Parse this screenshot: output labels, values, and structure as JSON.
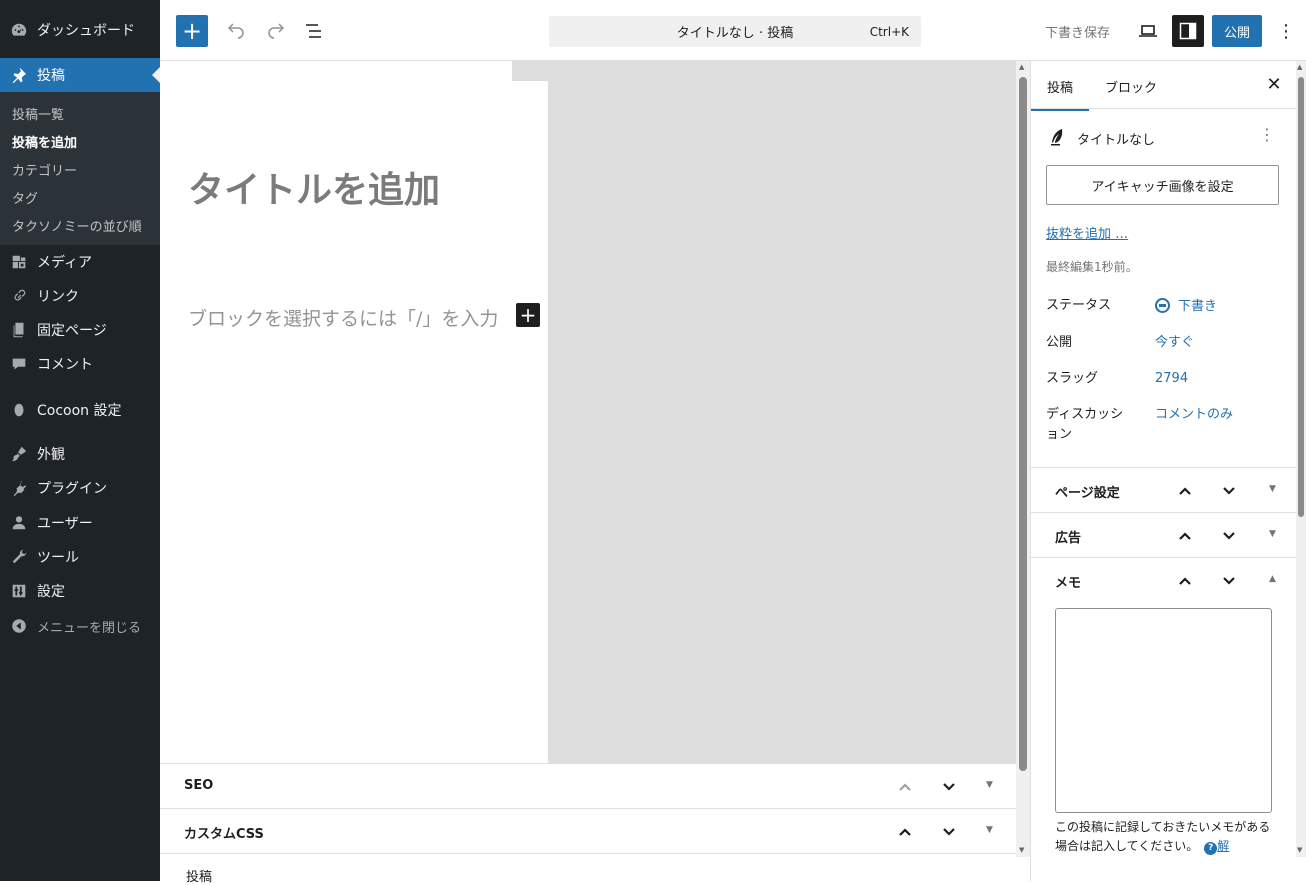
{
  "colors": {
    "accent": "#2271b1",
    "admin_bg": "#1d2327",
    "submenu_bg": "#2c3338",
    "canvas_bg": "#dddddd"
  },
  "admin_menu": {
    "dashboard": "ダッシュボード",
    "posts": "投稿",
    "posts_sub": [
      "投稿一覧",
      "投稿を追加",
      "カテゴリー",
      "タグ",
      "タクソノミーの並び順"
    ],
    "media": "メディア",
    "links": "リンク",
    "pages": "固定ページ",
    "comments": "コメント",
    "cocoon": "Cocoon 設定",
    "appearance": "外観",
    "plugins": "プラグイン",
    "users": "ユーザー",
    "tools": "ツール",
    "settings": "設定",
    "collapse": "メニューを閉じる"
  },
  "toolbar": {
    "command_title": "タイトルなし · 投稿",
    "command_shortcut": "Ctrl+K",
    "save_draft": "下書き保存",
    "publish": "公開"
  },
  "editor": {
    "title_placeholder": "タイトルを追加",
    "block_placeholder": "ブロックを選択するには「/」を入力"
  },
  "metaboxes": {
    "seo": "SEO",
    "custom_css": "カスタムCSS"
  },
  "footer": {
    "breadcrumb": "投稿"
  },
  "settings_sidebar": {
    "tabs": [
      "投稿",
      "ブロック"
    ],
    "post_title": "タイトルなし",
    "featured_image": "アイキャッチ画像を設定",
    "excerpt_link": "抜粋を追加 …",
    "last_edited": "最終編集1秒前。",
    "rows": [
      {
        "label": "ステータス",
        "value": "下書き"
      },
      {
        "label": "公開",
        "value": "今すぐ"
      },
      {
        "label": "スラッグ",
        "value": "2794"
      },
      {
        "label": "ディスカッション",
        "value": "コメントのみ"
      }
    ],
    "panels": [
      "ページ設定",
      "広告",
      "メモ"
    ],
    "memo_help": "この投稿に記録しておきたいメモがある場合は記入してください。",
    "memo_help_link": "解"
  }
}
